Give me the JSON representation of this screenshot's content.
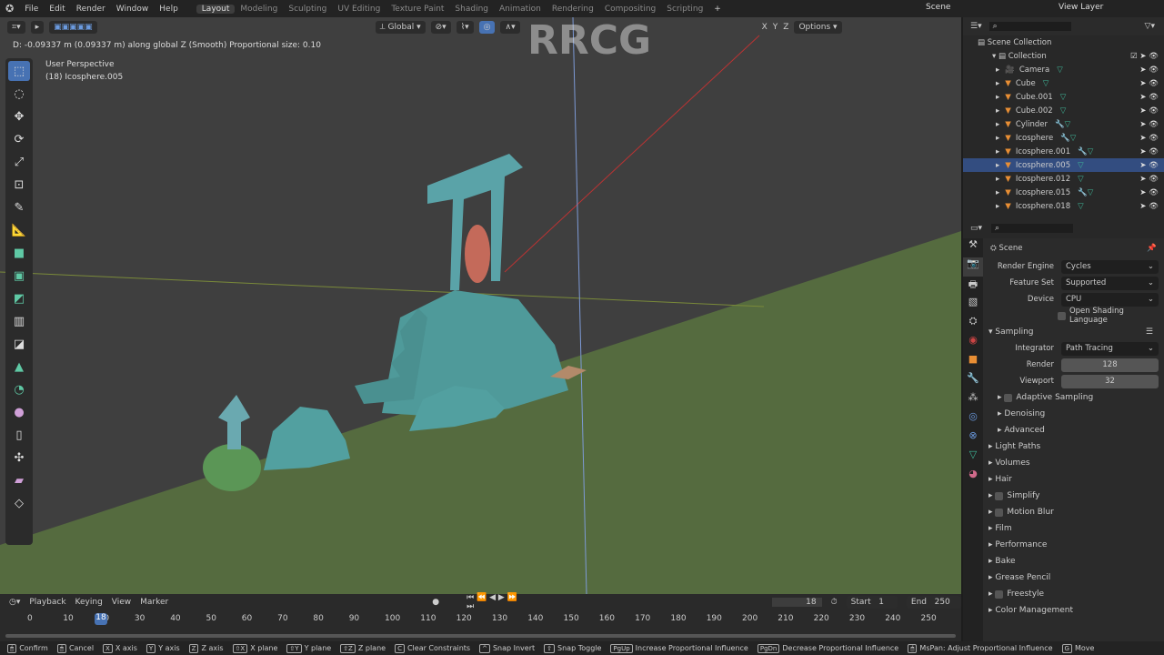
{
  "menu": {
    "items": [
      "File",
      "Edit",
      "Render",
      "Window",
      "Help"
    ],
    "workspaces": [
      "Layout",
      "Modeling",
      "Sculpting",
      "UV Editing",
      "Texture Paint",
      "Shading",
      "Animation",
      "Rendering",
      "Compositing",
      "Scripting"
    ],
    "active": "Layout",
    "scene": "Scene",
    "view_layer": "View Layer"
  },
  "viewport": {
    "header": {
      "orientation": "Global",
      "axes": [
        "X",
        "Y",
        "Z"
      ],
      "options": "Options"
    },
    "operator_info": "D: -0.09337 m (0.09337 m) along global Z (Smooth)   Proportional size: 0.10",
    "view_name": "User Perspective",
    "object_info": "(18) Icosphere.005",
    "watermark": "RRCG"
  },
  "outliner": {
    "root": "Scene Collection",
    "collection": "Collection",
    "items": [
      {
        "name": "Camera",
        "mods": "camera-data"
      },
      {
        "name": "Cube",
        "mods": "mesh"
      },
      {
        "name": "Cube.001",
        "mods": "mesh"
      },
      {
        "name": "Cube.002",
        "mods": "mesh"
      },
      {
        "name": "Cylinder",
        "mods": "wrench mesh"
      },
      {
        "name": "Icosphere",
        "mods": "wrench mesh"
      },
      {
        "name": "Icosphere.001",
        "mods": "wrench mesh"
      },
      {
        "name": "Icosphere.005",
        "mods": "mesh",
        "selected": true
      },
      {
        "name": "Icosphere.012",
        "mods": "mesh"
      },
      {
        "name": "Icosphere.015",
        "mods": "wrench mesh"
      },
      {
        "name": "Icosphere.018",
        "mods": "mesh"
      }
    ]
  },
  "properties": {
    "context": "Scene",
    "render_engine_label": "Render Engine",
    "render_engine": "Cycles",
    "feature_set_label": "Feature Set",
    "feature_set": "Supported",
    "device_label": "Device",
    "device": "CPU",
    "osl": "Open Shading Language",
    "sampling": "Sampling",
    "integrator_label": "Integrator",
    "integrator": "Path Tracing",
    "render_label": "Render",
    "render": "128",
    "viewport_label": "Viewport",
    "viewport": "32",
    "subpanels": [
      "Adaptive Sampling",
      "Denoising",
      "Advanced"
    ],
    "panels": [
      "Light Paths",
      "Volumes",
      "Hair",
      "Simplify",
      "Motion Blur",
      "Film",
      "Performance",
      "Bake",
      "Grease Pencil",
      "Freestyle",
      "Color Management"
    ]
  },
  "timeline": {
    "menus": [
      "Playback",
      "Keying",
      "View",
      "Marker"
    ],
    "current_frame": "18",
    "start_label": "Start",
    "start": "1",
    "end_label": "End",
    "end": "250",
    "ticks": [
      "0",
      "10",
      "20",
      "30",
      "40",
      "50",
      "60",
      "70",
      "80",
      "90",
      "100",
      "110",
      "120",
      "130",
      "140",
      "150",
      "160",
      "170",
      "180",
      "190",
      "200",
      "210",
      "220",
      "230",
      "240",
      "250"
    ]
  },
  "status": [
    [
      "",
      "Confirm"
    ],
    [
      "",
      "Cancel"
    ],
    [
      "X",
      "X axis"
    ],
    [
      "Y",
      "Y axis"
    ],
    [
      "Z",
      "Z axis"
    ],
    [
      "⇧X",
      "X plane"
    ],
    [
      "⇧Y",
      "Y plane"
    ],
    [
      "⇧Z",
      "Z plane"
    ],
    [
      "C",
      "Clear Constraints"
    ],
    [
      "^",
      "Snap Invert"
    ],
    [
      "⇧",
      "Snap Toggle"
    ],
    [
      "PgUp",
      "Increase Proportional Influence"
    ],
    [
      "PgDn",
      "Decrease Proportional Influence"
    ],
    [
      "",
      "MsPan: Adjust Proportional Influence"
    ],
    [
      "G",
      "Move"
    ]
  ],
  "colors": {
    "accent": "#4772b3",
    "ground": "#556b3f",
    "mesh": "#4f9a9a"
  }
}
